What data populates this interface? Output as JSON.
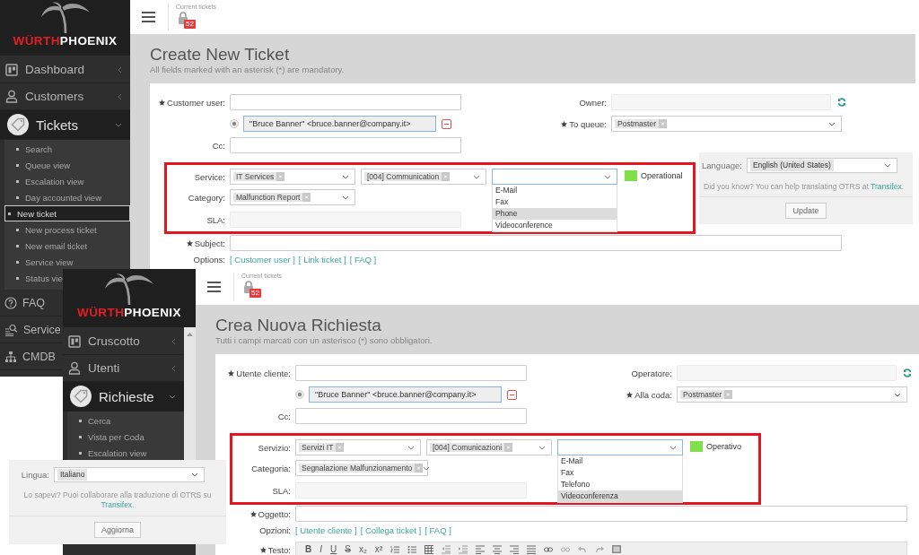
{
  "screens": [
    {
      "logo": {
        "text_1": "WÜRTH",
        "text_2": "PHOENIX"
      },
      "nav": [
        {
          "label": "Dashboard",
          "expanded": false
        },
        {
          "label": "Customers",
          "expanded": false
        },
        {
          "label": "Tickets",
          "expanded": true,
          "children": [
            {
              "label": "Search",
              "selected": false
            },
            {
              "label": "Queue view",
              "selected": false
            },
            {
              "label": "Escalation view",
              "selected": false
            },
            {
              "label": "Day accounted view",
              "selected": false
            },
            {
              "label": "New ticket",
              "selected": true
            },
            {
              "label": "New process ticket",
              "selected": false
            },
            {
              "label": "New email ticket",
              "selected": false
            },
            {
              "label": "Service view",
              "selected": false
            },
            {
              "label": "Status vie",
              "selected": false
            }
          ]
        },
        {
          "label": "FAQ"
        },
        {
          "label": "Service"
        },
        {
          "label": "CMDB"
        }
      ],
      "toolbar": {
        "label": "Current tickets",
        "count": "52"
      },
      "title": "Create New Ticket",
      "subtitle": "All fields marked with an asterisk (*) are mandatory.",
      "form": {
        "customer_user": {
          "label": "Customer user:",
          "required": true
        },
        "recipient": {
          "value": "\"Bruce Banner\" <bruce.banner@company.it>",
          "selected": true
        },
        "cc": {
          "label": "Cc:"
        },
        "owner": {
          "label": "Owner:"
        },
        "queue": {
          "label": "To queue:",
          "required": true,
          "value": "Postmaster"
        },
        "service": {
          "label": "Service:",
          "value": "IT Services"
        },
        "service_2": {
          "value": "[004] Communication"
        },
        "service_3": {
          "options": [
            {
              "label": "E-Mail",
              "selected": false
            },
            {
              "label": "Fax",
              "selected": false
            },
            {
              "label": "Phone",
              "selected": true
            },
            {
              "label": "Videoconference",
              "selected": false
            }
          ]
        },
        "status": {
          "label": "Operational",
          "color": "#80e04c"
        },
        "category": {
          "label": "Category:",
          "value": "Malfunction Report"
        },
        "sla": {
          "label": "SLA:"
        },
        "subject": {
          "label": "Subject:",
          "required": true
        },
        "options": {
          "label": "Options:",
          "links": [
            "[ Customer user ]",
            "[ Link ticket ]",
            "[ FAQ ]"
          ]
        }
      },
      "language": {
        "label": "Language:",
        "value": "English (United States)",
        "hint": "Did you know? You can help translating OTRS at",
        "link": "Transifex",
        "hint_end": ".",
        "button": "Update"
      }
    },
    {
      "logo": {
        "text_1": "WÜRTH",
        "text_2": "PHOENIX"
      },
      "nav": [
        {
          "label": "Cruscotto",
          "expanded": false
        },
        {
          "label": "Utenti",
          "expanded": false
        },
        {
          "label": "Richieste",
          "expanded": true,
          "children": [
            {
              "label": "Cerca",
              "selected": false
            },
            {
              "label": "Vista per Coda",
              "selected": false
            },
            {
              "label": "Escalation view",
              "selected": false
            }
          ]
        }
      ],
      "toolbar": {
        "label": "Current tickets",
        "count": "52"
      },
      "title": "Crea Nuova Richiesta",
      "subtitle": "Tutti i campi marcati con un asterisco (*) sono obbligatori.",
      "form": {
        "customer_user": {
          "label": "Utente cliente:",
          "required": true
        },
        "recipient": {
          "value": "\"Bruce Banner\" <bruce.banner@company.it>",
          "selected": true
        },
        "cc": {
          "label": "Cc:"
        },
        "owner": {
          "label": "Operatore:"
        },
        "queue": {
          "label": "Alla coda:",
          "required": true,
          "value": "Postmaster"
        },
        "service": {
          "label": "Servizio:",
          "value": "Servizi IT"
        },
        "service_2": {
          "value": "[004] Comunicazioni"
        },
        "service_3": {
          "options": [
            {
              "label": "E-Mail",
              "selected": false
            },
            {
              "label": "Fax",
              "selected": false
            },
            {
              "label": "Telefono",
              "selected": false
            },
            {
              "label": "Videoconferenza",
              "selected": true
            }
          ]
        },
        "status": {
          "label": "Operativo",
          "color": "#80e04c"
        },
        "category": {
          "label": "Categoria:",
          "value": "Segnalazione Malfunzionamento"
        },
        "sla": {
          "label": "SLA:"
        },
        "subject": {
          "label": "Oggetto:",
          "required": true
        },
        "options": {
          "label": "Opzioni:",
          "links": [
            "[ Utente cliente ]",
            "[ Collega ticket ]",
            "[ FAQ ]"
          ]
        },
        "body": {
          "label": "Testo:",
          "required": true,
          "tools": [
            "B",
            "I",
            "U",
            "S",
            "x₂",
            "x²"
          ]
        }
      },
      "language": {
        "label": "Lingua:",
        "value": "Italiano",
        "hint": "Lo sapevi? Puoi collaborare alla traduzione di OTRS su",
        "link": "Transifex",
        "hint_end": ".",
        "button": "Aggiorna"
      }
    }
  ]
}
